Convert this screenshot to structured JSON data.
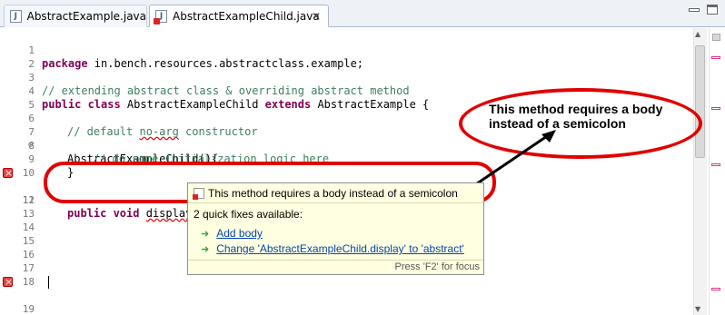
{
  "tabs": [
    {
      "label": "AbstractExample.java",
      "icon": "java-file-icon"
    },
    {
      "label": "AbstractExampleChild.java",
      "icon": "java-file-error-icon",
      "active": true,
      "close": "✕"
    }
  ],
  "editor": {
    "lines": [
      {
        "n": "1"
      },
      {
        "n": "2"
      },
      {
        "n": "3"
      },
      {
        "n": "4"
      },
      {
        "n": "5"
      },
      {
        "n": "6"
      },
      {
        "n": "7"
      },
      {
        "n": "8"
      },
      {
        "n": "9"
      },
      {
        "n": "10"
      },
      {
        "n": "11"
      },
      {
        "n": "12"
      },
      {
        "n": "13"
      },
      {
        "n": "14"
      },
      {
        "n": "15"
      },
      {
        "n": "16"
      },
      {
        "n": "17"
      },
      {
        "n": "18"
      },
      {
        "n": "19"
      }
    ],
    "code": {
      "l1_kw": "package",
      "l1_rest": " in.bench.resources.abstractclass.example;",
      "l3": "// extending abstract class & overriding abstract method",
      "l4_kw1": "public class",
      "l4_name": " AbstractExampleChild ",
      "l4_kw2": "extends",
      "l4_rest": " AbstractExample {",
      "l6_a": "// default ",
      "l6_b": "no-arg",
      "l6_c": " constructor",
      "l7": "AbstractExampleChild(){",
      "l8": "// do some initialization logic here",
      "l9": "}",
      "l11_kw": "public void",
      "l11_sp": " ",
      "l11_name": "display();",
      "l19": "}"
    }
  },
  "annotation": {
    "callout_line1": "This method requires a body",
    "callout_line2": "instead of a semicolon"
  },
  "popup": {
    "title": "This method requires a body instead of a semicolon",
    "count": "2 quick fixes available:",
    "fixes": [
      {
        "label": "Add body"
      },
      {
        "label": "Change 'AbstractExampleChild.display' to 'abstract'"
      }
    ],
    "footer": "Press 'F2' for focus"
  },
  "colors": {
    "keyword": "#7f0055",
    "comment": "#3f7f5f",
    "annotation_red": "#e10000",
    "popup_bg": "#ffffe1",
    "link": "#0645ad"
  }
}
